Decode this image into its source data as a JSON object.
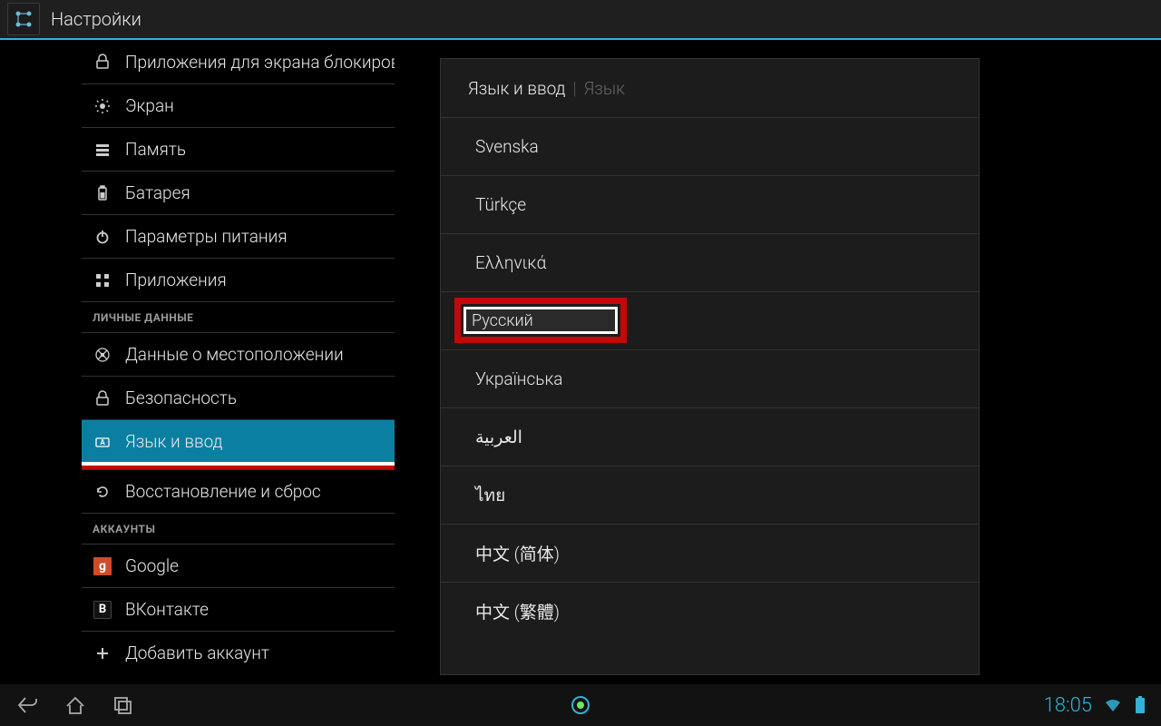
{
  "titlebar": {
    "title": "Настройки"
  },
  "sidebar": {
    "items": [
      {
        "icon": "lock",
        "label": "Приложения для экрана блокировки"
      },
      {
        "icon": "gear",
        "label": "Экран"
      },
      {
        "icon": "storage",
        "label": "Память"
      },
      {
        "icon": "battery",
        "label": "Батарея"
      },
      {
        "icon": "power",
        "label": "Параметры питания"
      },
      {
        "icon": "apps",
        "label": "Приложения"
      }
    ],
    "section_personal": "ЛИЧНЫЕ ДАННЫЕ",
    "personal": [
      {
        "icon": "location",
        "label": "Данные о местоположении"
      },
      {
        "icon": "lock",
        "label": "Безопасность"
      },
      {
        "icon": "keyboard",
        "label": "Язык и ввод",
        "selected": true
      },
      {
        "icon": "reset",
        "label": "Восстановление и сброс"
      }
    ],
    "section_accounts": "АККАУНТЫ",
    "accounts": [
      {
        "icon": "google",
        "label": "Google"
      },
      {
        "icon": "vk",
        "label": "ВКонтакте"
      },
      {
        "icon": "plus",
        "label": "Добавить аккаунт"
      }
    ]
  },
  "main": {
    "breadcrumb_primary": "Язык и ввод",
    "breadcrumb_secondary": "Язык",
    "languages": [
      {
        "label": "Svenska"
      },
      {
        "label": "Türkçe"
      },
      {
        "label": "Ελληνικά"
      },
      {
        "label": "Русский",
        "highlighted": true
      },
      {
        "label": "Українська"
      },
      {
        "label": "العربية",
        "rtl": true
      },
      {
        "label": "ไทย"
      },
      {
        "label": "中文 (简体)"
      },
      {
        "label": "中文 (繁體)"
      }
    ]
  },
  "navbar": {
    "time": "18:05"
  }
}
